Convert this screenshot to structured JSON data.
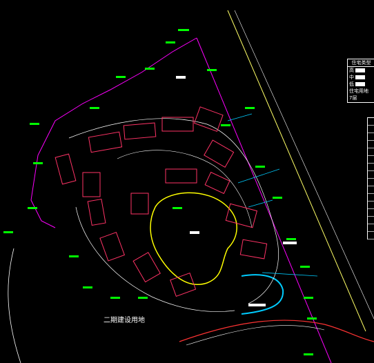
{
  "drawing": {
    "phase_label": "二期建设用地",
    "legend": {
      "title": "住宅类型",
      "rows": [
        "高",
        "中",
        "低",
        "住宅用地",
        "7层"
      ]
    },
    "colors": {
      "background": "#000000",
      "site_boundary": "#ff00ff",
      "buildings": "#ff3366",
      "roads": "#ffffff",
      "lake_edge": "#ffff00",
      "stream": "#00ccff",
      "annotation": "#00ff00",
      "highway": "#ffff66"
    },
    "icon_names": [
      "building-block",
      "lake",
      "stream",
      "annotation-tag",
      "road-line"
    ]
  }
}
